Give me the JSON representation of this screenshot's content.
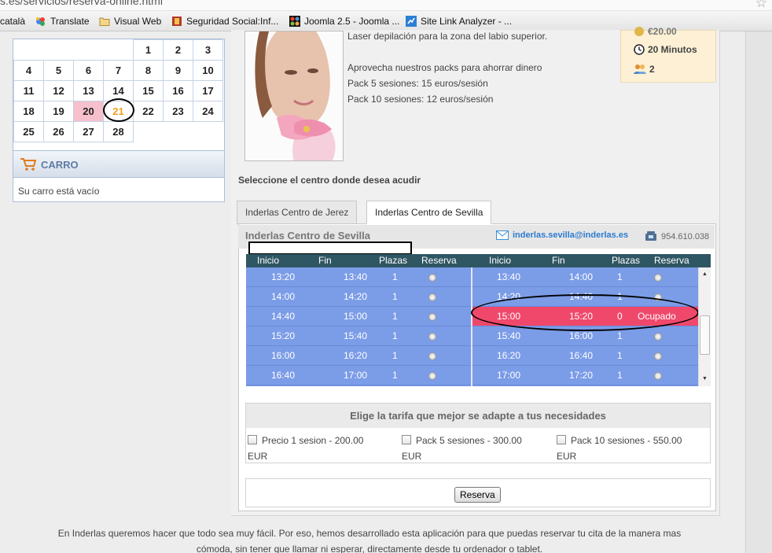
{
  "browser": {
    "url_visible": "s.es/servicios/reserva-online.html",
    "bookmarks": [
      {
        "label": "català"
      },
      {
        "label": "Translate"
      },
      {
        "label": "Visual Web"
      },
      {
        "label": "Seguridad Social:Inf..."
      },
      {
        "label": "Joomla 2.5 - Joomla ..."
      },
      {
        "label": "Site Link Analyzer - ..."
      }
    ]
  },
  "calendar": {
    "weeks": [
      [
        "",
        "",
        "",
        "",
        "1",
        "2",
        "3"
      ],
      [
        "4",
        "5",
        "6",
        "7",
        "8",
        "9",
        "10"
      ],
      [
        "11",
        "12",
        "13",
        "14",
        "15",
        "16",
        "17"
      ],
      [
        "18",
        "19",
        "20",
        "21",
        "22",
        "23",
        "24"
      ],
      [
        "25",
        "26",
        "27",
        "28",
        "",
        "",
        ""
      ]
    ],
    "today": "20",
    "selected": "21",
    "selected_color": "#f0a020",
    "today_color": "#f6c0cd"
  },
  "cart": {
    "title": "CARRO",
    "message": "Su carro está vacío"
  },
  "service": {
    "lines": [
      "Laser depilación para la zona del labio superior.",
      "",
      "Aprovecha nuestros packs para ahorrar dinero",
      "Pack 5 sesiones: 15 euros/sesión",
      "Pack 10 sesiones: 12 euros/sesión"
    ],
    "price_partial": "€20.00",
    "duration": "20 Minutos",
    "people": "2"
  },
  "select_label": "Seleccione el centro donde desea acudir",
  "tabs": [
    {
      "label": "Inderlas Centro de Jerez",
      "active": false
    },
    {
      "label": "Inderlas Centro de Sevilla",
      "active": true
    }
  ],
  "center": {
    "title": "Inderlas Centro de Sevilla",
    "email": "inderlas.sevilla@inderlas.es",
    "phone": "954.610.038"
  },
  "schedule": {
    "headers": [
      "Inicio",
      "Fin",
      "Plazas",
      "Reserva",
      "Inicio",
      "Fin",
      "Plazas",
      "Reserva"
    ],
    "left_rows": [
      {
        "start": "13:20",
        "end": "13:40",
        "slots": "1"
      },
      {
        "start": "14:00",
        "end": "14:20",
        "slots": "1"
      },
      {
        "start": "14:40",
        "end": "15:00",
        "slots": "1"
      },
      {
        "start": "15:20",
        "end": "15:40",
        "slots": "1"
      },
      {
        "start": "16:00",
        "end": "16:20",
        "slots": "1"
      },
      {
        "start": "16:40",
        "end": "17:00",
        "slots": "1"
      }
    ],
    "right_rows": [
      {
        "start": "13:40",
        "end": "14:00",
        "slots": "1",
        "status": ""
      },
      {
        "start": "14:20",
        "end": "14:40",
        "slots": "1",
        "status": ""
      },
      {
        "start": "15:00",
        "end": "15:20",
        "slots": "0",
        "status": "Ocupado"
      },
      {
        "start": "15:40",
        "end": "16:00",
        "slots": "1",
        "status": ""
      },
      {
        "start": "16:20",
        "end": "16:40",
        "slots": "1",
        "status": ""
      },
      {
        "start": "17:00",
        "end": "17:20",
        "slots": "1",
        "status": ""
      }
    ],
    "row_color": "#7b9ce7",
    "busy_color": "#f0486b",
    "header_color": "#2f5663"
  },
  "tariffs": {
    "title": "Elige la tarifa que mejor se adapte a tus necesidades",
    "options": [
      {
        "label": "Precio 1 sesion - 200.00",
        "currency": "EUR"
      },
      {
        "label": "Pack 5 sesiones - 300.00",
        "currency": "EUR"
      },
      {
        "label": "Pack 10 sesiones - 550.00",
        "currency": "EUR"
      }
    ]
  },
  "reserva_button": "Reserva",
  "footer": {
    "line1": "En Inderlas queremos hacer que todo sea muy fácil. Por eso, hemos desarrollado esta aplicación para que puedas reservar tu cita de la manera mas",
    "line2": "cómoda, sin tener que llamar ni esperar, directamente desde tu ordenador o tablet."
  }
}
